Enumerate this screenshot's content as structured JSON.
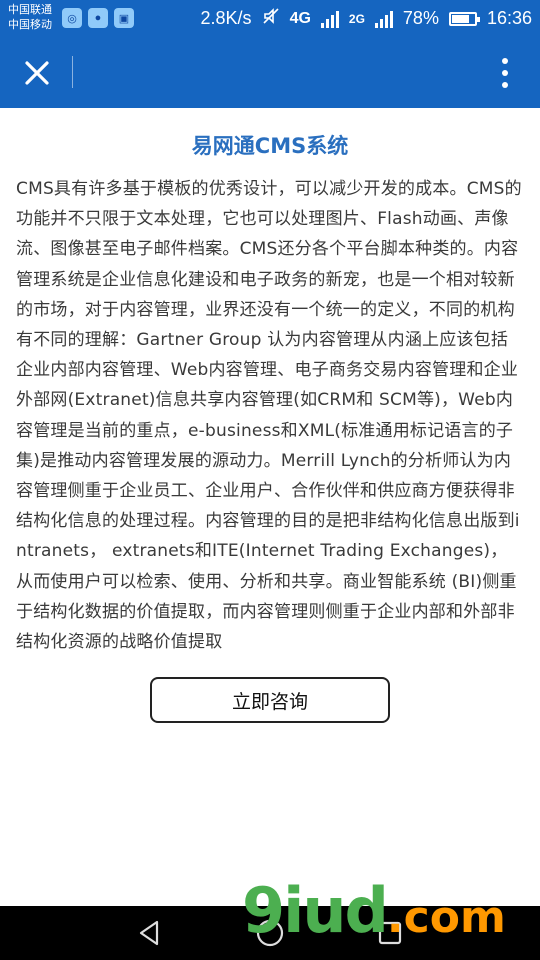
{
  "status_bar": {
    "carrier_1": "中国联通",
    "carrier_2": "中国移动",
    "speed": "2.8K/s",
    "network_1": "4G",
    "network_2": "2G",
    "battery": "78%",
    "battery_level": 0.78,
    "time": "16:36"
  },
  "content": {
    "title": "易网通CMS系统",
    "body": "CMS具有许多基于模板的优秀设计，可以减少开发的成本。CMS的功能并不只限于文本处理，它也可以处理图片、Flash动画、声像流、图像甚至电子邮件档案。CMS还分各个平台脚本种类的。内容管理系统是企业信息化建设和电子政务的新宠，也是一个相对较新的市场，对于内容管理，业界还没有一个统一的定义，不同的机构有不同的理解：Gartner Group 认为内容管理从内涵上应该包括企业内部内容管理、Web内容管理、电子商务交易内容管理和企业外部网(Extranet)信息共享内容管理(如CRM和 SCM等)，Web内容管理是当前的重点，e-business和XML(标准通用标记语言的子集)是推动内容管理发展的源动力。Merrill Lynch的分析师认为内容管理侧重于企业员工、企业用户、合作伙伴和供应商方便获得非结构化信息的处理过程。内容管理的目的是把非结构化信息出版到intranets， extranets和ITE(Internet Trading Exchanges)， 从而使用户可以检索、使用、分析和共享。商业智能系统 (BI)侧重于结构化数据的价值提取，而内容管理则侧重于企业内部和外部非结构化资源的战略价值提取",
    "cta_label": "立即咨询"
  },
  "watermark": {
    "text": "9iud",
    "suffix": ".com"
  },
  "colors": {
    "app_bar": "#1565c0",
    "title": "#2a6fbf"
  }
}
